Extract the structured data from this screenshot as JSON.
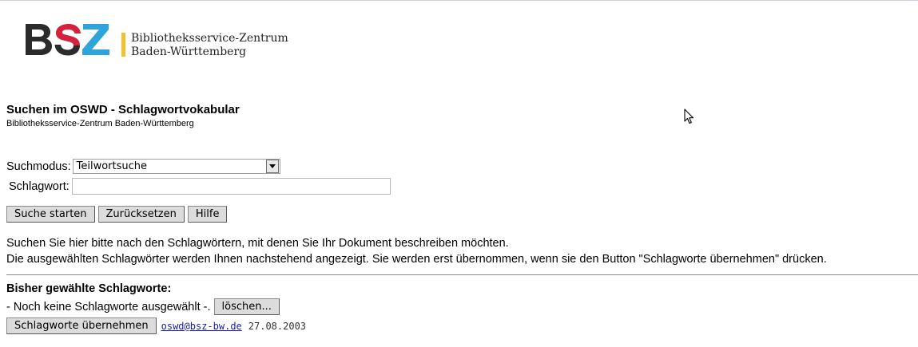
{
  "logo": {
    "letters": "BSZ",
    "line1": "Bibliotheksservice-Zentrum",
    "line2": "Baden-Württemberg",
    "colors": {
      "b": "#2b2b2b",
      "s_top": "#d4213d",
      "s_bottom": "#2b2b2b",
      "z": "#2fa3dc",
      "bar": "#f2c12e"
    }
  },
  "header": {
    "title": "Suchen im OSWD - Schlagwortvokabular",
    "subtitle": "Bibliotheksservice-Zentrum Baden-Württemberg"
  },
  "form": {
    "mode_label": "Suchmodus:",
    "mode_value": "Teilwortsuche",
    "keyword_label": "Schlagwort:",
    "keyword_value": "",
    "buttons": {
      "search": "Suche starten",
      "reset": "Zurücksetzen",
      "help": "Hilfe"
    }
  },
  "help": {
    "line1": "Suchen Sie hier bitte nach den Schlagwörtern, mit denen Sie Ihr Dokument beschreiben möchten.",
    "line2": "Die ausgewählten Schlagwörter werden Ihnen nachstehend angezeigt. Sie werden erst übernommen, wenn sie den Button \"Schlagworte übernehmen\" drücken."
  },
  "chosen": {
    "title": "Bisher gewählte Schlagworte:",
    "empty_text": "- Noch keine Schlagworte ausgewählt -.",
    "delete_button": "löschen...",
    "apply_button": "Schlagworte übernehmen",
    "email": "oswd@bsz-bw.de",
    "date": "27.08.2003"
  }
}
